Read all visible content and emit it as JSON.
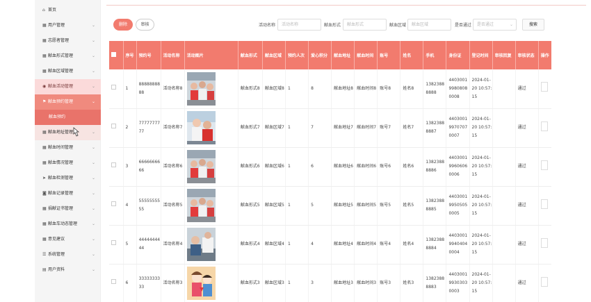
{
  "sidebar": {
    "items": [
      {
        "label": "首页",
        "icon": "home-icon",
        "glyph": "⌂",
        "chevron": false,
        "style": ""
      },
      {
        "label": "用户管理",
        "icon": "grid-icon",
        "glyph": "▦",
        "chevron": true,
        "style": ""
      },
      {
        "label": "志愿者管理",
        "icon": "grid-icon",
        "glyph": "▦",
        "chevron": true,
        "style": ""
      },
      {
        "label": "献血形式管理",
        "icon": "grid-icon",
        "glyph": "▦",
        "chevron": true,
        "style": ""
      },
      {
        "label": "献血区域管理",
        "icon": "grid-icon",
        "glyph": "▦",
        "chevron": true,
        "style": ""
      },
      {
        "label": "献血活动管理",
        "icon": "pin-icon",
        "glyph": "◉",
        "chevron": true,
        "style": "pinkish"
      },
      {
        "label": "献血预约管理",
        "icon": "flag-icon",
        "glyph": "⚑",
        "chevron": true,
        "style": "active"
      },
      {
        "label": "献血地址管理",
        "icon": "grid-icon",
        "glyph": "▦",
        "chevron": true,
        "style": "hover"
      },
      {
        "label": "献血时间管理",
        "icon": "grid-icon",
        "glyph": "▦",
        "chevron": true,
        "style": ""
      },
      {
        "label": "献血情况管理",
        "icon": "grid-icon",
        "glyph": "▦",
        "chevron": true,
        "style": ""
      },
      {
        "label": "献血检测管理",
        "icon": "send-icon",
        "glyph": "➤",
        "chevron": true,
        "style": ""
      },
      {
        "label": "献血记录管理",
        "icon": "camera-icon",
        "glyph": "◙",
        "chevron": true,
        "style": ""
      },
      {
        "label": "捐献证书管理",
        "icon": "grid-icon",
        "glyph": "▦",
        "chevron": true,
        "style": ""
      },
      {
        "label": "献血车动态管理",
        "icon": "grid-icon",
        "glyph": "▦",
        "chevron": true,
        "style": ""
      },
      {
        "label": "意见建议",
        "icon": "grid-icon",
        "glyph": "▦",
        "chevron": true,
        "style": ""
      },
      {
        "label": "系统管理",
        "icon": "list-icon",
        "glyph": "☰",
        "chevron": true,
        "style": ""
      },
      {
        "label": "用户资料",
        "icon": "profile-icon",
        "glyph": "▤",
        "chevron": true,
        "style": ""
      }
    ],
    "submenu": {
      "after_index": 6,
      "label": "献血预约"
    }
  },
  "toolbar": {
    "add_label": "删除",
    "audit_label": "审核",
    "search_label": "搜索",
    "filters": [
      {
        "label": "活动名称",
        "placeholder": "活动名称",
        "select": false
      },
      {
        "label": "献血形式",
        "placeholder": "献血形式",
        "select": false
      },
      {
        "label": "献血区域",
        "placeholder": "献血区域",
        "select": false
      },
      {
        "label": "是否通过",
        "placeholder": "是否通过",
        "select": true
      }
    ]
  },
  "table": {
    "headers": [
      "序号",
      "预约号",
      "活动名称",
      "活动图片",
      "献血形式",
      "献血区域",
      "预约人次",
      "爱心积分",
      "献血地址",
      "献血时间",
      "账号",
      "姓名",
      "手机",
      "身份证",
      "登记时间",
      "审核回复",
      "审核状态",
      "操作"
    ],
    "rows": [
      {
        "no": "1",
        "code": "8888888888",
        "name": "活动名称8",
        "form": "献血形式8",
        "area": "献血区域8",
        "count": "1",
        "points": "8",
        "addr": "献血地址8",
        "time": "献血时间8",
        "account": "账号8",
        "person": "姓名8",
        "phone": "13823888888",
        "idcard": "440300199808080008",
        "regtime": "2024-01-20 10:57:15",
        "reply": "",
        "status": "通过",
        "img": "photo-hands"
      },
      {
        "no": "2",
        "code": "7777777777",
        "name": "活动名称7",
        "form": "献血形式7",
        "area": "献血区域7",
        "count": "1",
        "points": "7",
        "addr": "献血地址7",
        "time": "献血时间7",
        "account": "账号7",
        "person": "姓名7",
        "phone": "13823888887",
        "idcard": "440300199707070007",
        "regtime": "2024-01-20 10:57:15",
        "reply": "",
        "status": "通过",
        "img": "photo-nurse"
      },
      {
        "no": "3",
        "code": "6666666666",
        "name": "活动名称6",
        "form": "献血形式6",
        "area": "献血区域6",
        "count": "1",
        "points": "6",
        "addr": "献血地址6",
        "time": "献血时间6",
        "account": "账号6",
        "person": "姓名6",
        "phone": "13823888886",
        "idcard": "440300199606060006",
        "regtime": "2024-01-20 10:57:15",
        "reply": "",
        "status": "通过",
        "img": "photo-hands"
      },
      {
        "no": "4",
        "code": "5555555555",
        "name": "活动名称5",
        "form": "献血形式5",
        "area": "献血区域5",
        "count": "1",
        "points": "5",
        "addr": "献血地址5",
        "time": "献血时间5",
        "account": "账号5",
        "person": "姓名5",
        "phone": "13823888885",
        "idcard": "440300199505050005",
        "regtime": "2024-01-20 10:57:15",
        "reply": "",
        "status": "通过",
        "img": "photo-hands"
      },
      {
        "no": "5",
        "code": "4444444444",
        "name": "活动名称4",
        "form": "献血形式4",
        "area": "献血区域4",
        "count": "1",
        "points": "4",
        "addr": "献血地址4",
        "time": "献血时间4",
        "account": "账号4",
        "person": "姓名4",
        "phone": "13823888884",
        "idcard": "440300199404040004",
        "regtime": "2024-01-20 10:57:15",
        "reply": "",
        "status": "通过",
        "img": "photo-donor"
      },
      {
        "no": "6",
        "code": "3333333333",
        "name": "活动名称3",
        "form": "献血形式3",
        "area": "献血区域3",
        "count": "1",
        "points": "3",
        "addr": "献血地址3",
        "time": "献血时间3",
        "account": "账号3",
        "person": "姓名3",
        "phone": "13823888883",
        "idcard": "440300199303030003",
        "regtime": "2024-01-20 10:57:15",
        "reply": "",
        "status": "通过",
        "img": "photo-cartoon"
      }
    ]
  },
  "colors": {
    "accent": "#f27b6e",
    "active_menu": "#f08a7e",
    "submenu": "#e9736a"
  }
}
